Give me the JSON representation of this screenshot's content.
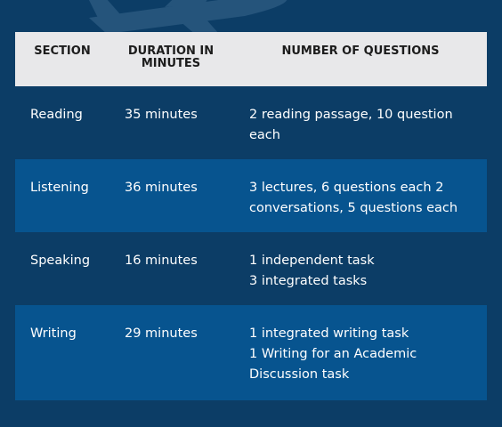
{
  "headers": {
    "section": "SECTION",
    "duration": [
      "DURATION IN",
      "MINUTES"
    ],
    "questions": "NUMBER OF QUESTIONS"
  },
  "rows": [
    {
      "section": "Reading",
      "duration": "35 minutes",
      "questions": [
        "2 reading passage, 10 question",
        "each"
      ]
    },
    {
      "section": "Listening",
      "duration": "36 minutes",
      "questions": [
        "3 lectures, 6 questions each 2",
        "conversations, 5 questions each"
      ]
    },
    {
      "section": "Speaking",
      "duration": "16 minutes",
      "questions": [
        "1 independent task",
        "3 integrated tasks"
      ]
    },
    {
      "section": "Writing",
      "duration": "29 minutes",
      "questions": [
        "1 integrated writing task",
        "1 Writing for an Academic",
        "Discussion task"
      ]
    }
  ],
  "colors": {
    "background": "#0c3d66",
    "row_dark": "#0c3d66",
    "row_light": "#07548f",
    "header_bg": "#e8e8ea",
    "header_text": "#1c1c1c",
    "body_text": "#ffffff"
  },
  "icons": [
    "airplane-icon"
  ]
}
